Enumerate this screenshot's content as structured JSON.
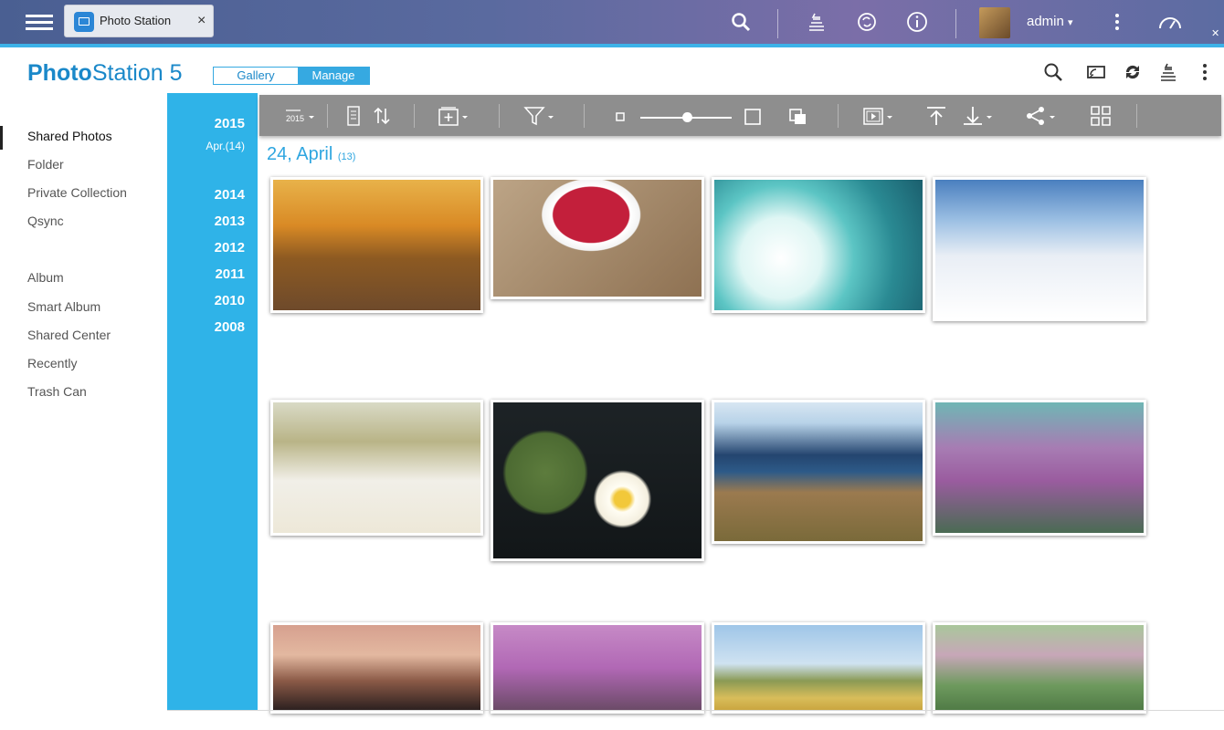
{
  "topbar": {
    "tab_title": "Photo Station",
    "tab_close": "×",
    "user": "admin",
    "user_caret": "▾"
  },
  "header": {
    "logo_bold": "Photo",
    "logo_rest": "Station 5",
    "gallery": "Gallery",
    "manage": "Manage"
  },
  "sidebar": {
    "items": [
      {
        "label": "Shared Photos"
      },
      {
        "label": "Folder"
      },
      {
        "label": "Private Collection"
      },
      {
        "label": "Qsync"
      },
      {
        "label": "Album"
      },
      {
        "label": "Smart Album"
      },
      {
        "label": "Shared Center"
      },
      {
        "label": "Recently"
      },
      {
        "label": "Trash Can"
      }
    ]
  },
  "timeline": {
    "current_year": "2015",
    "current_month": "Apr.(14)",
    "years": [
      "2014",
      "2013",
      "2012",
      "2011",
      "2010",
      "2008"
    ]
  },
  "toolbar": {
    "year_icon_text": "2015"
  },
  "content": {
    "date_label": "24, April",
    "date_count": "(13)"
  },
  "colors": {
    "accent": "#2fb3e8",
    "brand": "#1a88c9",
    "toolbar": "#8e8e8e"
  }
}
